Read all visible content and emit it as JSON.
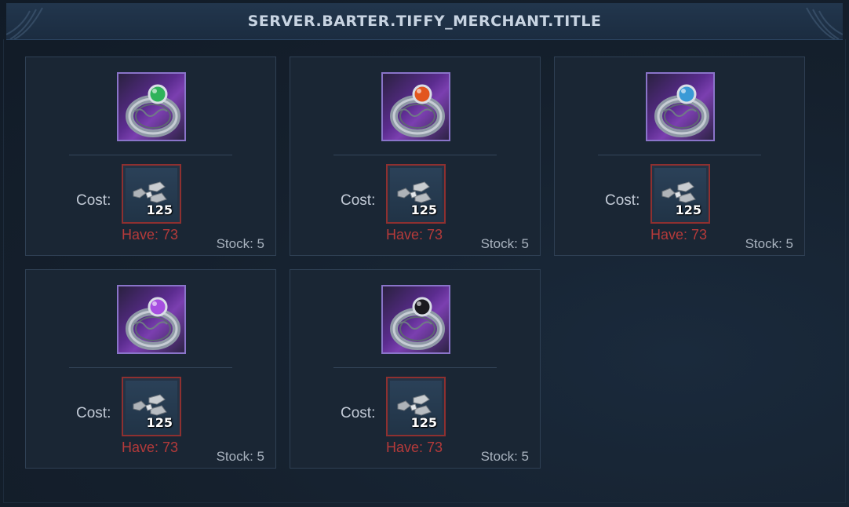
{
  "window": {
    "title": "SERVER.BARTER.TIFFY_MERCHANT.TITLE"
  },
  "items": [
    {
      "icon": "ring-winged-green-gem-icon",
      "gem_color": "#2fb35a",
      "cost_label": "Cost:",
      "cost_icon": "ore-chunks-icon",
      "cost_qty": "125",
      "have": "Have: 73",
      "stock": "Stock: 5"
    },
    {
      "icon": "ring-flame-orange-gem-icon",
      "gem_color": "#e2561e",
      "cost_label": "Cost:",
      "cost_icon": "ore-chunks-icon",
      "cost_qty": "125",
      "have": "Have: 73",
      "stock": "Stock: 5"
    },
    {
      "icon": "ring-blue-gem-icon",
      "gem_color": "#3a9ad6",
      "cost_label": "Cost:",
      "cost_icon": "ore-chunks-icon",
      "cost_qty": "125",
      "have": "Have: 73",
      "stock": "Stock: 5"
    },
    {
      "icon": "ring-purple-gem-icon",
      "gem_color": "#a64fe0",
      "cost_label": "Cost:",
      "cost_icon": "ore-chunks-icon",
      "cost_qty": "125",
      "have": "Have: 73",
      "stock": "Stock: 5"
    },
    {
      "icon": "ring-black-gem-icon",
      "gem_color": "#1a1a1e",
      "cost_label": "Cost:",
      "cost_icon": "ore-chunks-icon",
      "cost_qty": "125",
      "have": "Have: 73",
      "stock": "Stock: 5"
    }
  ],
  "colors": {
    "have_insufficient": "#b53a3a",
    "cost_slot_border": "#8e3030",
    "icon_border": "#8a74c9"
  }
}
